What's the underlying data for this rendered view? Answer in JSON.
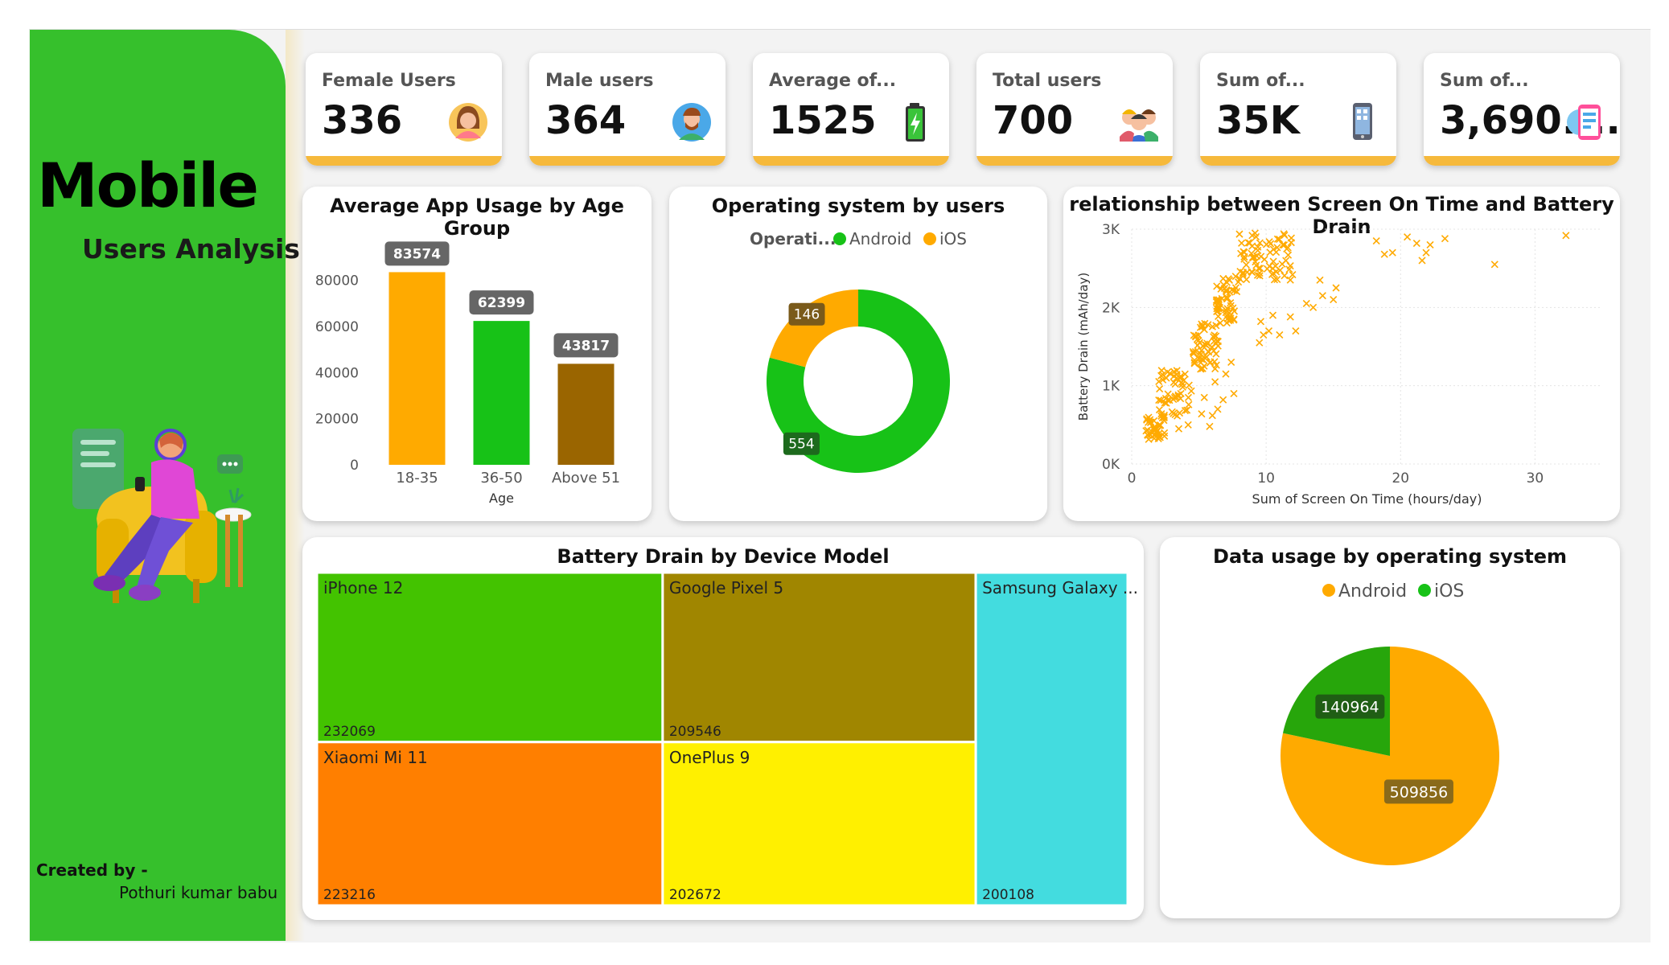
{
  "sidebar": {
    "title": "Mobile",
    "subtitle": "Users Analysis",
    "created_by_label": "Created by -",
    "author": "Pothuri kumar babu"
  },
  "kpis": [
    {
      "label": "Female Users",
      "value": "336",
      "icon": "female-avatar-icon"
    },
    {
      "label": "Male users",
      "value": "364",
      "icon": "male-avatar-icon"
    },
    {
      "label": "Average of...",
      "value": "1525",
      "icon": "battery-icon"
    },
    {
      "label": "Total users",
      "value": "700",
      "icon": "users-group-icon"
    },
    {
      "label": "Sum of...",
      "value": "35K",
      "icon": "phone-icon"
    },
    {
      "label": "Sum of...",
      "value": "3,690....",
      "icon": "phone-data-icon"
    }
  ],
  "colors": {
    "green": "#17c217",
    "orange": "#ffaa00",
    "brown": "#9a6500",
    "sidebar": "#36c02c",
    "kpi_accent": "#f6b93b"
  },
  "chart_data": [
    {
      "id": "age-usage",
      "type": "bar",
      "title": "Average App Usage by Age Group",
      "xlabel": "Age",
      "ylabel": "",
      "categories": [
        "18-35",
        "36-50",
        "Above 51"
      ],
      "values": [
        83574,
        62399,
        43817
      ],
      "value_labels": [
        "83574",
        "62399",
        "43817"
      ],
      "bar_colors": [
        "#ffaa00",
        "#17c217",
        "#9a6500"
      ],
      "yticks": [
        "0",
        "20000",
        "40000",
        "60000",
        "80000"
      ],
      "ylim": [
        0,
        90000
      ],
      "grid": false
    },
    {
      "id": "os-users",
      "type": "pie",
      "donut": true,
      "title": "Operating system by users",
      "legend_title": "Operati...",
      "legend_position": "top",
      "labels": [
        "Android",
        "iOS"
      ],
      "values": [
        554,
        146
      ],
      "value_labels": [
        "554",
        "146"
      ],
      "colors": [
        "#17c217",
        "#ffaa00"
      ]
    },
    {
      "id": "screen-battery",
      "type": "scatter",
      "title": "relationship between Screen On Time and Battery Drain",
      "xlabel": "Sum of Screen On Time (hours/day)",
      "ylabel": "Battery Drain (mAh/day)",
      "xticks": [
        "0",
        "10",
        "20",
        "30"
      ],
      "yticks": [
        "0K",
        "1K",
        "2K",
        "3K"
      ],
      "xlim": [
        0,
        35
      ],
      "ylim": [
        0,
        3000
      ],
      "marker": "x",
      "color": "#ffaa00",
      "grid": true,
      "clusters": [
        {
          "x": [
            1,
            2.5
          ],
          "y": [
            300,
            600
          ],
          "n": 40
        },
        {
          "x": [
            2,
            4.5
          ],
          "y": [
            600,
            1200
          ],
          "n": 55
        },
        {
          "x": [
            4.5,
            6.5
          ],
          "y": [
            1200,
            1800
          ],
          "n": 60
        },
        {
          "x": [
            6.3,
            8
          ],
          "y": [
            1800,
            2400
          ],
          "n": 55
        },
        {
          "x": [
            8,
            12
          ],
          "y": [
            2350,
            2950
          ],
          "n": 75
        }
      ],
      "points": [
        [
          3.5,
          450
        ],
        [
          4.2,
          500
        ],
        [
          5.8,
          480
        ],
        [
          6.0,
          620
        ],
        [
          6.4,
          700
        ],
        [
          5.2,
          640
        ],
        [
          6.8,
          820
        ],
        [
          7.6,
          900
        ],
        [
          5.4,
          850
        ],
        [
          6.2,
          1050
        ],
        [
          7.0,
          1150
        ],
        [
          7.4,
          1300
        ],
        [
          9.5,
          1550
        ],
        [
          9.8,
          1650
        ],
        [
          10.2,
          1700
        ],
        [
          11.0,
          1650
        ],
        [
          12.2,
          1700
        ],
        [
          9.6,
          1820
        ],
        [
          10.5,
          1900
        ],
        [
          11.8,
          1880
        ],
        [
          13.0,
          2050
        ],
        [
          13.5,
          2000
        ],
        [
          14.2,
          2150
        ],
        [
          15.0,
          2100
        ],
        [
          15.2,
          2250
        ],
        [
          14.0,
          2350
        ],
        [
          18.2,
          2850
        ],
        [
          18.8,
          2680
        ],
        [
          19.4,
          2700
        ],
        [
          20.5,
          2900
        ],
        [
          21.2,
          2820
        ],
        [
          21.6,
          2600
        ],
        [
          21.9,
          2700
        ],
        [
          22.2,
          2800
        ],
        [
          23.3,
          2880
        ],
        [
          27.0,
          2550
        ],
        [
          32.3,
          2920
        ]
      ]
    },
    {
      "id": "battery-model",
      "type": "treemap",
      "title": "Battery Drain by Device Model",
      "items": [
        {
          "label": "iPhone 12",
          "value": 232069,
          "value_label": "232069",
          "color": "#43c300"
        },
        {
          "label": "Google Pixel 5",
          "value": 209546,
          "value_label": "209546",
          "color": "#a08600"
        },
        {
          "label": "Samsung Galaxy ...",
          "value": 200108,
          "value_label": "200108",
          "color": "#43dcdf"
        },
        {
          "label": "Xiaomi Mi 11",
          "value": 223216,
          "value_label": "223216",
          "color": "#ff7f00"
        },
        {
          "label": "OnePlus 9",
          "value": 202672,
          "value_label": "202672",
          "color": "#fff000"
        }
      ]
    },
    {
      "id": "data-usage",
      "type": "pie",
      "title": "Data usage by operating system",
      "legend_position": "top",
      "labels": [
        "Android",
        "iOS"
      ],
      "values": [
        509856,
        140964
      ],
      "value_labels": [
        "509856",
        "140964"
      ],
      "colors": [
        "#ffaa00",
        "#27a60b"
      ]
    }
  ]
}
